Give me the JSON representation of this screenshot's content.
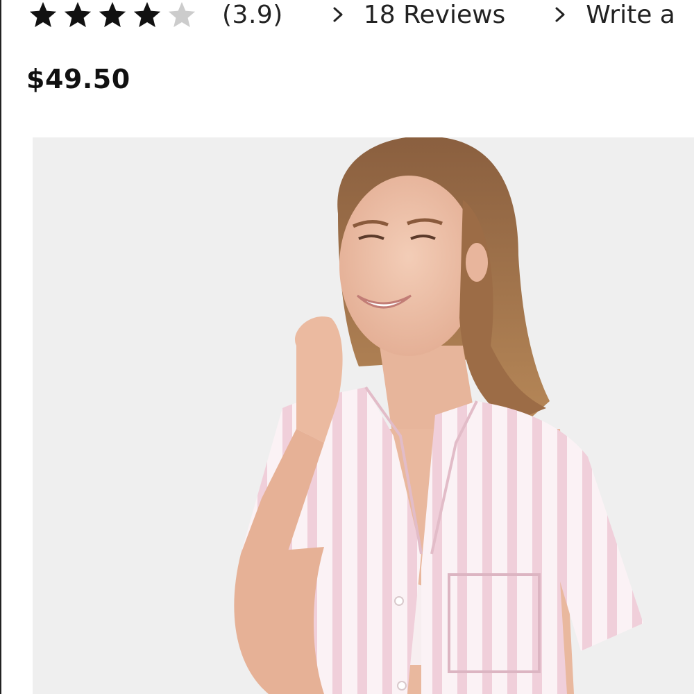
{
  "product": {
    "rating": {
      "value": 3.9,
      "display": "(3.9)",
      "stars_total": 5,
      "stars_filled": 4,
      "filled_color": "#111111",
      "empty_color": "#cccccc"
    },
    "reviews_link": {
      "icon": "chevron-right-icon",
      "label": "18 Reviews"
    },
    "write_review_link": {
      "icon": "chevron-right-icon",
      "label": "Write a"
    },
    "price": "$49.50",
    "image": {
      "description_icon": "product-photo",
      "background_color": "#efefef",
      "garment_color": "#f3d9e1"
    }
  }
}
